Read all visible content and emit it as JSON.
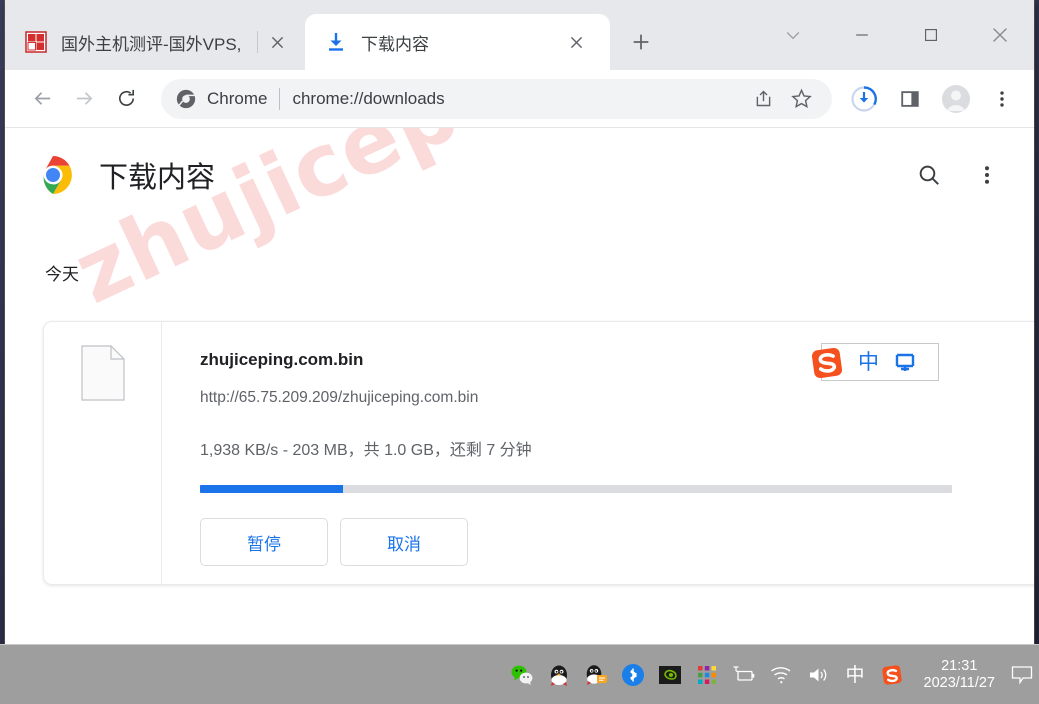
{
  "window": {
    "tabs": [
      {
        "title": "国外主机测评-国外VPS,",
        "favicon": "site-favicon-red-seal",
        "active": false
      },
      {
        "title": "下载内容",
        "favicon": "download-arrow-icon",
        "active": true
      }
    ],
    "new_tab_label": "+",
    "controls": [
      {
        "name": "tab-search",
        "glyph": "chevron-down-icon"
      },
      {
        "name": "minimize",
        "glyph": "minimize-icon"
      },
      {
        "name": "maximize",
        "glyph": "maximize-icon"
      },
      {
        "name": "close",
        "glyph": "close-icon"
      }
    ]
  },
  "toolbar": {
    "back_icon": "arrow-back-icon",
    "forward_icon": "arrow-forward-icon",
    "reload_icon": "reload-icon",
    "omnibox": {
      "brand": "Chrome",
      "url": "chrome://downloads",
      "share_icon": "share-icon",
      "bookmark_icon": "star-icon"
    },
    "downloads_icon": "downloads-progress-icon",
    "side_panel_icon": "side-panel-icon",
    "profile_icon": "profile-avatar-icon",
    "menu_icon": "three-dot-menu-icon"
  },
  "page": {
    "title": "下载内容",
    "logo": "chrome-logo",
    "search_icon": "search-icon",
    "menu_icon": "three-dot-menu-icon",
    "watermark": "zhujiceping.com",
    "section_date": "今天",
    "download": {
      "file_icon": "generic-file-icon",
      "file_name": "zhujiceping.com.bin",
      "url": "http://65.75.209.209/zhujiceping.com.bin",
      "status": "1,938 KB/s - 203 MB，共 1.0 GB，还剩 7 分钟",
      "progress_percent": 19,
      "progress_color": "#1a73e8",
      "pause_label": "暂停",
      "cancel_label": "取消"
    }
  },
  "ime": {
    "logo": "sogou-logo-icon",
    "mode": "中",
    "keyboard_icon": "soft-keyboard-icon"
  },
  "taskbar": {
    "tray_icons": [
      "wechat-icon",
      "qq-penguin-icon",
      "qq-message-icon",
      "bluetooth-icon",
      "nvidia-icon",
      "color-grid-icon",
      "battery-icon",
      "wifi-icon",
      "volume-icon",
      "ime-chinese-icon",
      "sogou-icon"
    ],
    "clock_time": "21:31",
    "clock_date": "2023/11/27",
    "notification_icon": "notification-bubble-icon"
  }
}
